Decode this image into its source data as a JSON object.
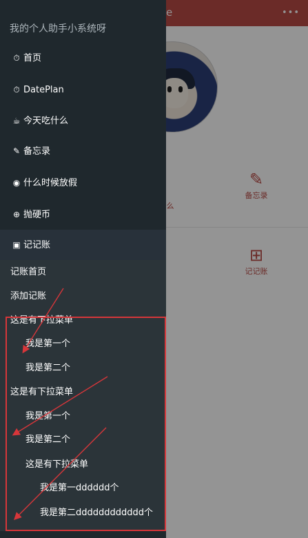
{
  "background": {
    "header_title_fragment": "e",
    "header_more": "•••",
    "grid_items": [
      {
        "label": "备忘录",
        "icon": "pencil-icon"
      },
      {
        "label": "记记账",
        "icon": "ledger-icon"
      }
    ],
    "fragment_label": "么"
  },
  "sidebar": {
    "title": "我的个人助手小系统呀",
    "items": [
      {
        "label": "首页",
        "icon": "timer-icon"
      },
      {
        "label": "DatePlan",
        "icon": "timer-icon"
      },
      {
        "label": "今天吃什么",
        "icon": "bowl-icon"
      },
      {
        "label": "备忘录",
        "icon": "pencil-icon"
      },
      {
        "label": "什么时候放假",
        "icon": "clock-icon"
      },
      {
        "label": "抛硬币",
        "icon": "globe-icon"
      },
      {
        "label": "记记账",
        "icon": "ledger-icon"
      }
    ],
    "submenu": [
      {
        "label": "记账首页"
      },
      {
        "label": "添加记账"
      },
      {
        "label": "这是有下拉菜单"
      },
      {
        "label": "我是第一个"
      },
      {
        "label": "我是第二个"
      },
      {
        "label": "这是有下拉菜单"
      },
      {
        "label": "我是第一个"
      },
      {
        "label": "我是第二个"
      },
      {
        "label": "这是有下拉菜单"
      },
      {
        "label": "我是第一dddddd个"
      },
      {
        "label": "我是第二dddddddddddd个"
      }
    ]
  },
  "colors": {
    "sidebar_bg": "#1f282d",
    "submenu_bg": "#2b3439",
    "accent": "#b84a45",
    "annotation": "#d7363a"
  }
}
